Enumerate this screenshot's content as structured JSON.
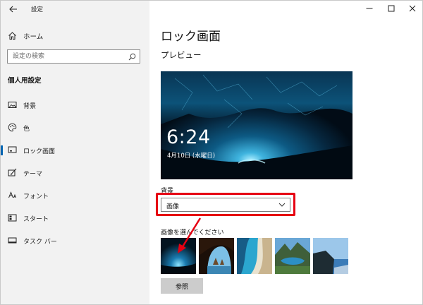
{
  "window": {
    "app_title": "設定"
  },
  "sidebar": {
    "home_label": "ホーム",
    "search": {
      "placeholder": "設定の検索",
      "value": ""
    },
    "section_title": "個人用設定",
    "items": [
      {
        "label": "背景",
        "icon": "image-icon",
        "selected": false
      },
      {
        "label": "色",
        "icon": "palette-icon",
        "selected": false
      },
      {
        "label": "ロック画面",
        "icon": "lock-screen-icon",
        "selected": true
      },
      {
        "label": "テーマ",
        "icon": "theme-brush-icon",
        "selected": false
      },
      {
        "label": "フォント",
        "icon": "font-icon",
        "selected": false
      },
      {
        "label": "スタート",
        "icon": "start-icon",
        "selected": false
      },
      {
        "label": "タスク バー",
        "icon": "taskbar-icon",
        "selected": false
      }
    ]
  },
  "main": {
    "page_title": "ロック画面",
    "preview_title": "プレビュー",
    "preview": {
      "time": "6:24",
      "date": "4月10日 (水曜日)"
    },
    "background_label": "背景",
    "background_value": "画像",
    "choose_label": "画像を選んでください",
    "browse_label": "参照",
    "thumbnails": [
      {
        "name": "ice-cave"
      },
      {
        "name": "sea-cave"
      },
      {
        "name": "aerial-beach"
      },
      {
        "name": "mountain-lake"
      },
      {
        "name": "coastal-cliff"
      }
    ]
  },
  "colors": {
    "accent": "#0063b1",
    "highlight": "#e60012",
    "sidebar_bg": "#f2f2f2"
  }
}
